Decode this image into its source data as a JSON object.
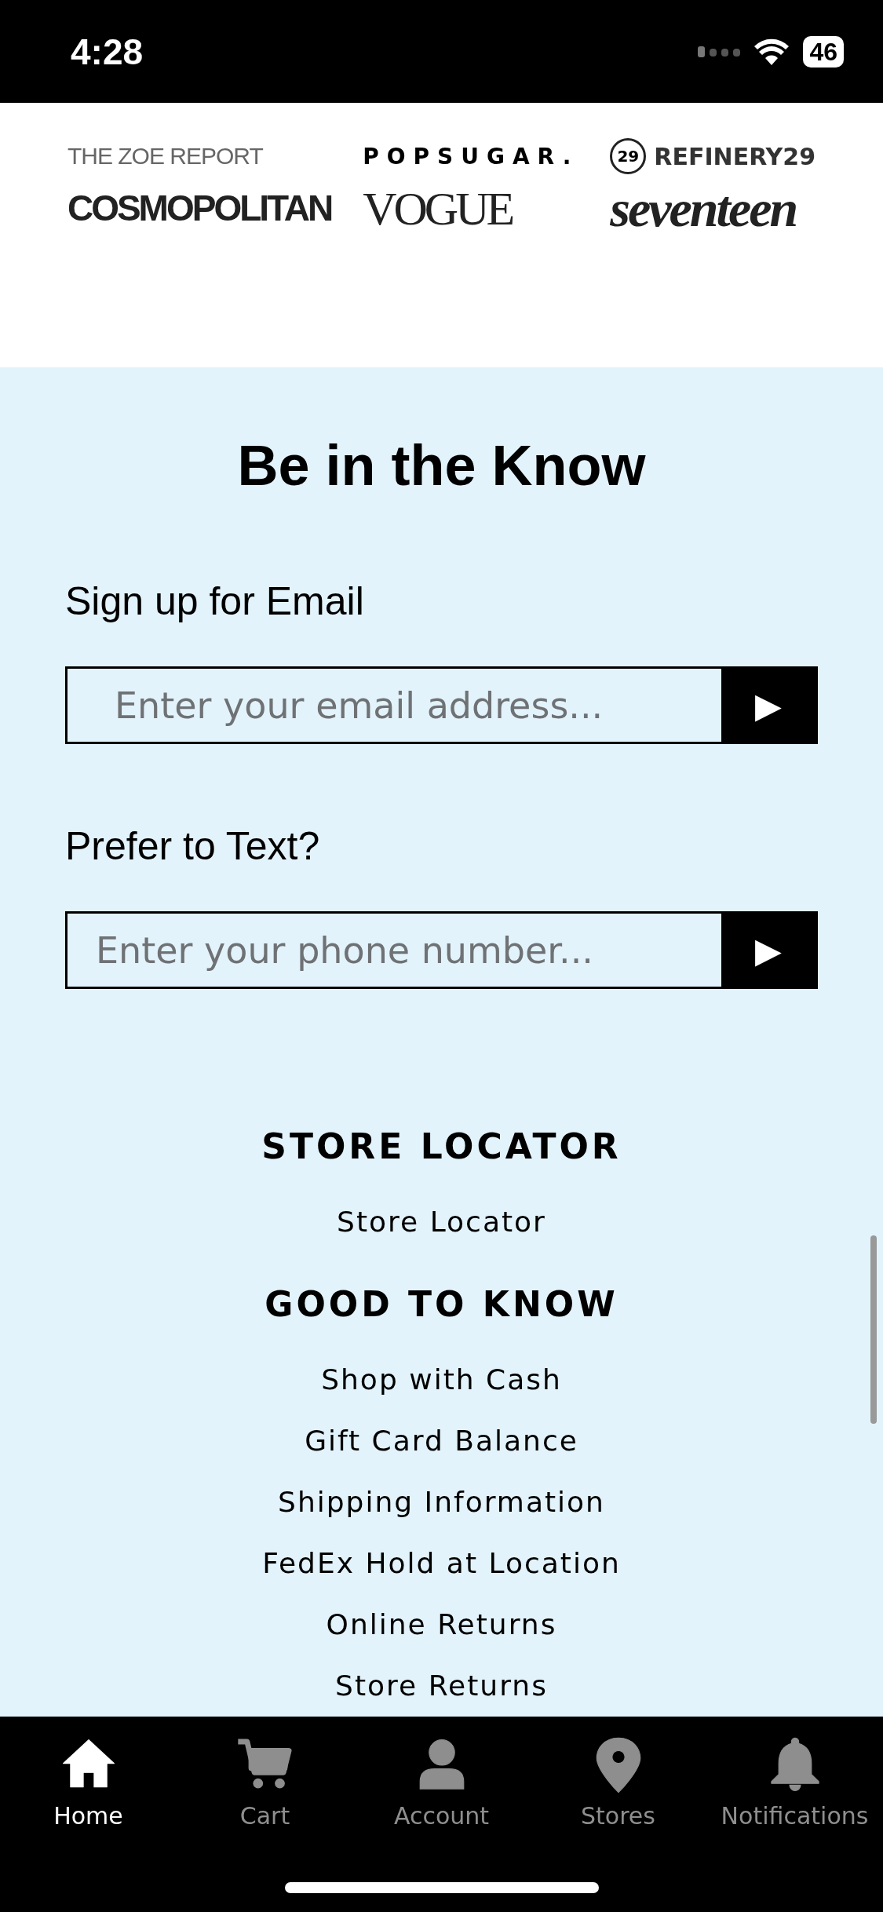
{
  "status_bar": {
    "time": "4:28",
    "battery": "46"
  },
  "press_logos": [
    {
      "text": "THE ZOE REPORT",
      "kind": "thin"
    },
    {
      "text": "POPSUGAR.",
      "kind": "spaced"
    },
    {
      "text": "REFINERY29",
      "kind": "circle",
      "mark": "29"
    },
    {
      "text": "COSMOPOLITAN",
      "kind": "condensed"
    },
    {
      "text": "VOGUE",
      "kind": "serif"
    },
    {
      "text": "seventeen",
      "kind": "script"
    }
  ],
  "newsletter": {
    "title": "Be in the Know",
    "forms": [
      {
        "label": "Sign up for Email",
        "placeholder": "Enter your email address...",
        "button": "▶"
      },
      {
        "label": "Prefer to Text?",
        "placeholder": "Enter your phone number...",
        "button": "▶"
      }
    ]
  },
  "footer_sections": [
    {
      "heading": "STORE LOCATOR",
      "links": [
        "Store Locator"
      ]
    },
    {
      "heading": "GOOD TO KNOW",
      "links": [
        "Shop with Cash",
        "Gift Card Balance",
        "Shipping Information",
        "FedEx Hold at Location",
        "Online Returns",
        "Store Returns"
      ]
    }
  ],
  "tab_bar": [
    {
      "label": "Home",
      "selected": true
    },
    {
      "label": "Cart",
      "selected": false
    },
    {
      "label": "Account",
      "selected": false
    },
    {
      "label": "Stores",
      "selected": false
    },
    {
      "label": "Notifications",
      "selected": false
    }
  ]
}
